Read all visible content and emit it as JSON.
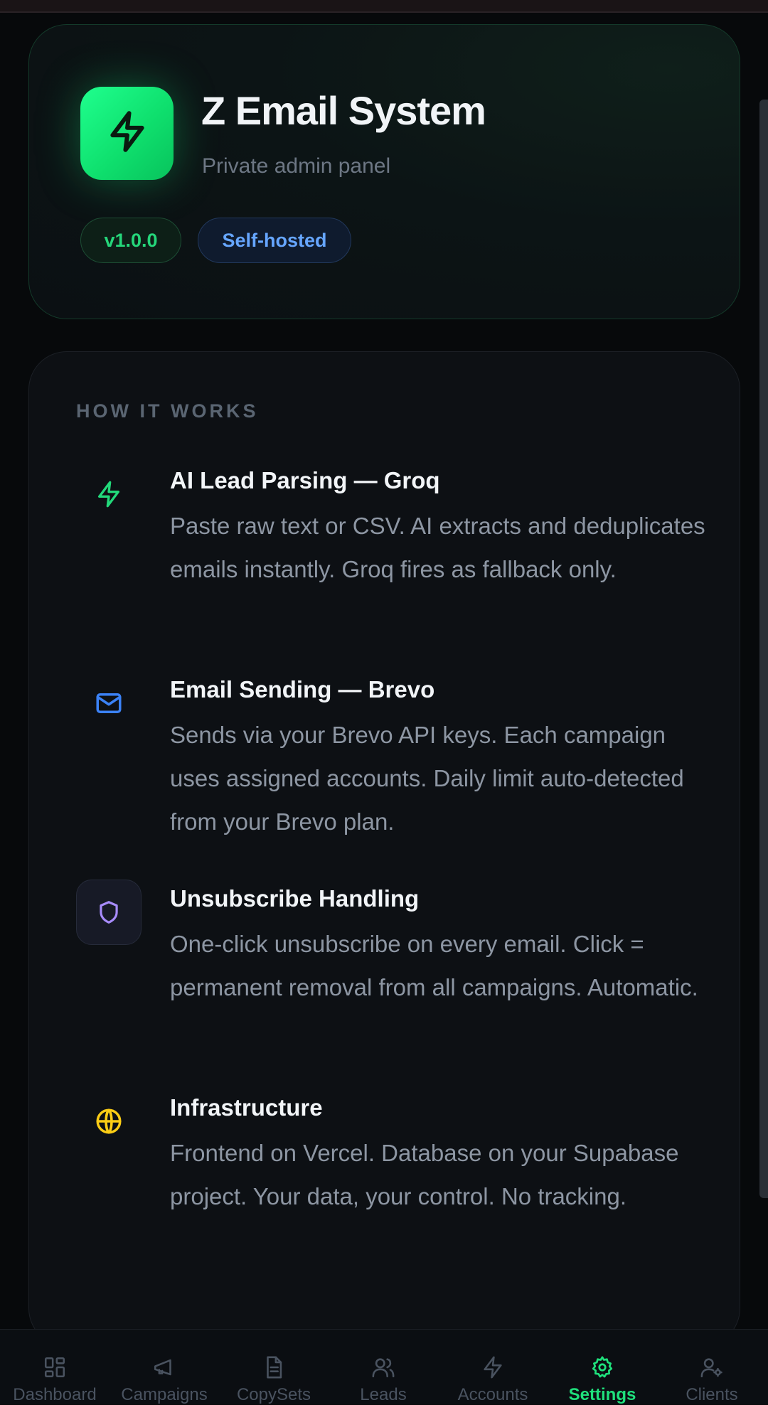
{
  "app": {
    "title": "Z Email System",
    "subtitle": "Private admin panel",
    "icon": "bolt-icon",
    "accent": "#1fe07c"
  },
  "badges": {
    "version": "v1.0.0",
    "hosting": "Self-hosted"
  },
  "how_it_works": {
    "heading": "HOW IT WORKS",
    "features": [
      {
        "icon": "bolt-icon",
        "icon_color": "#22d97a",
        "title": "AI Lead Parsing — Groq",
        "description": "Paste raw text or CSV. AI extracts and deduplicates emails instantly. Groq fires as fallback only."
      },
      {
        "icon": "mail-icon",
        "icon_color": "#3b82f6",
        "title": "Email Sending — Brevo",
        "description": "Sends via your Brevo API keys. Each campaign uses assigned accounts. Daily limit auto-detected from your Brevo plan."
      },
      {
        "icon": "shield-icon",
        "icon_color": "#a78bfa",
        "title": "Unsubscribe Handling",
        "description": "One-click unsubscribe on every email. Click = permanent removal from all campaigns. Automatic."
      },
      {
        "icon": "globe-icon",
        "icon_color": "#facc15",
        "title": "Infrastructure",
        "description": "Frontend on Vercel. Database on your Supabase project. Your data, your control. No tracking."
      }
    ]
  },
  "nav": {
    "active": "Settings",
    "items": [
      {
        "label": "Dashboard",
        "icon": "dashboard-icon"
      },
      {
        "label": "Campaigns",
        "icon": "megaphone-icon"
      },
      {
        "label": "CopySets",
        "icon": "document-icon"
      },
      {
        "label": "Leads",
        "icon": "users-icon"
      },
      {
        "label": "Accounts",
        "icon": "bolt-icon"
      },
      {
        "label": "Settings",
        "icon": "gear-icon"
      },
      {
        "label": "Clients",
        "icon": "user-gear-icon"
      }
    ]
  }
}
